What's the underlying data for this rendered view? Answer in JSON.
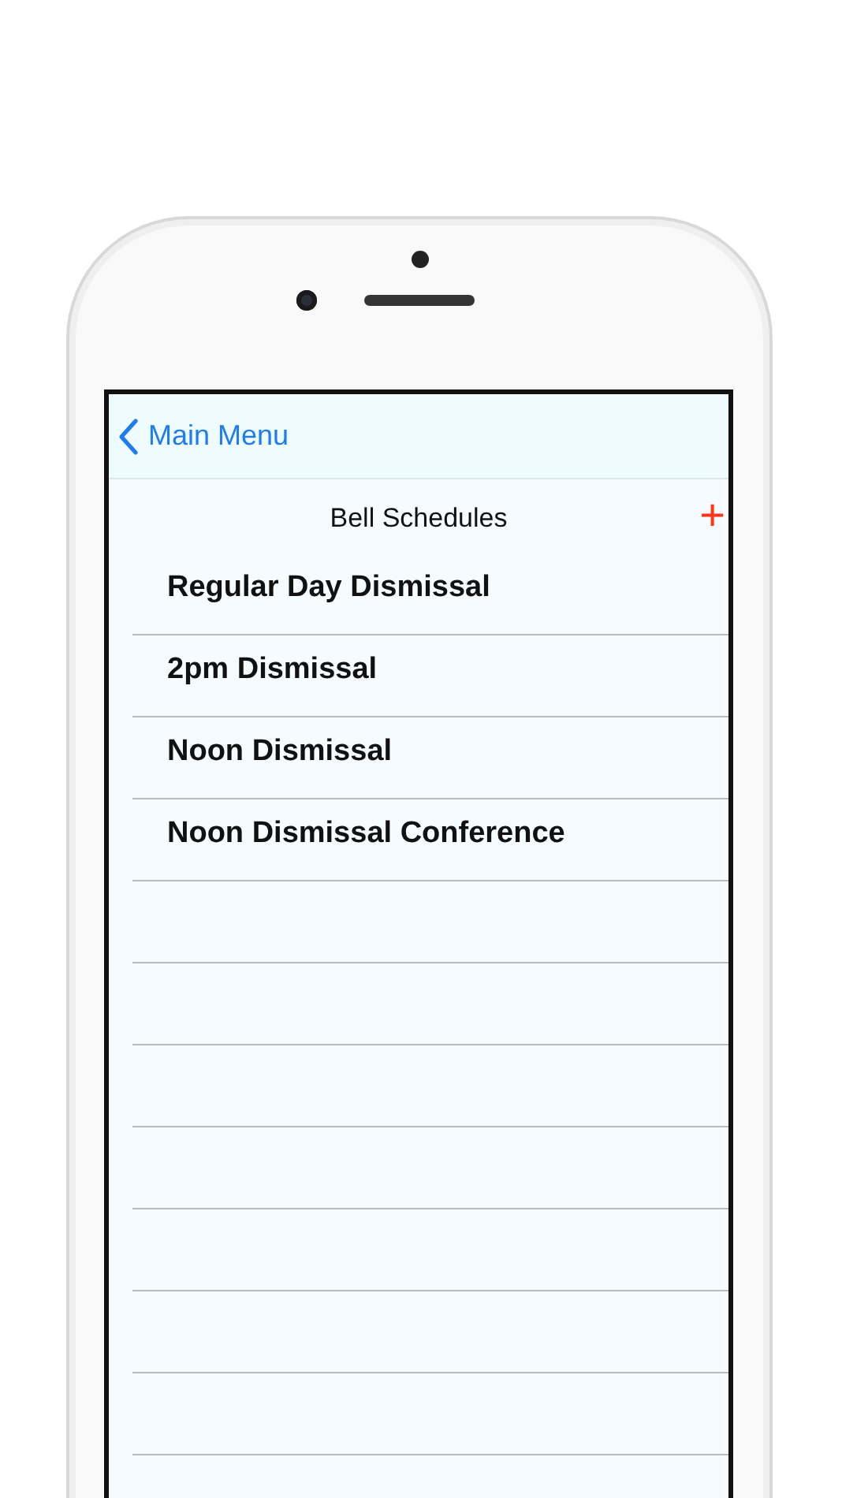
{
  "nav": {
    "back_label": "Main Menu"
  },
  "title": "Bell Schedules",
  "add_button": "+",
  "schedules": [
    {
      "name": "Regular Day Dismissal"
    },
    {
      "name": "2pm Dismissal"
    },
    {
      "name": "Noon Dismissal"
    },
    {
      "name": "Noon Dismissal Conference"
    }
  ]
}
